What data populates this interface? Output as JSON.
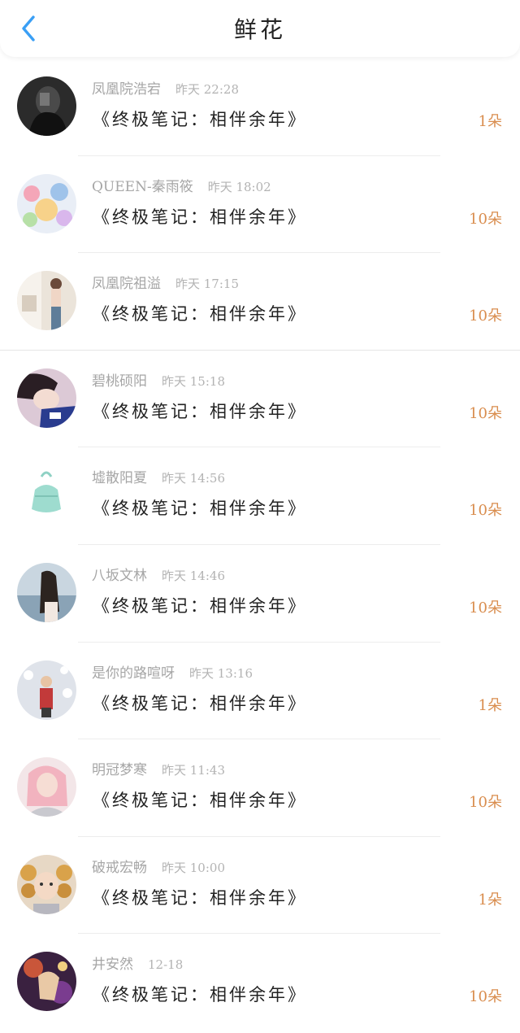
{
  "header": {
    "title": "鲜花",
    "back_icon": "chevron-left-icon",
    "accent_color": "#3a9ff5"
  },
  "colors": {
    "count": "#d98d4e",
    "meta": "#a6a6a6"
  },
  "rows": [
    {
      "name": "凤凰院浩宕",
      "time": "昨天 22:28",
      "book": "《终极笔记：相伴余年》",
      "count": "1朵",
      "avatar": "dark-portrait"
    },
    {
      "name": "QUEEN-秦雨筱",
      "time": "昨天 18:02",
      "book": "《终极笔记：相伴余年》",
      "count": "10朵",
      "avatar": "cartoon-art"
    },
    {
      "name": "凤凰院祖溢",
      "time": "昨天 17:15",
      "book": "《终极笔记：相伴余年》",
      "count": "10朵",
      "avatar": "room-photo"
    },
    {
      "name": "碧桃硕阳",
      "time": "昨天 15:18",
      "book": "《终极笔记：相伴余年》",
      "count": "10朵",
      "avatar": "person-photo"
    },
    {
      "name": "墟散阳夏",
      "time": "昨天 14:56",
      "book": "《终极笔记：相伴余年》",
      "count": "10朵",
      "avatar": "green-bag"
    },
    {
      "name": "八坂文林",
      "time": "昨天 14:46",
      "book": "《终极笔记：相伴余年》",
      "count": "10朵",
      "avatar": "sea-portrait"
    },
    {
      "name": "是你的路喧呀",
      "time": "昨天 13:16",
      "book": "《终极笔记：相伴余年》",
      "count": "1朵",
      "avatar": "snow-figure"
    },
    {
      "name": "明冠梦寒",
      "time": "昨天 11:43",
      "book": "《终极笔记：相伴余年》",
      "count": "10朵",
      "avatar": "pink-hair"
    },
    {
      "name": "破戒宏畅",
      "time": "昨天 10:00",
      "book": "《终极笔记：相伴余年》",
      "count": "1朵",
      "avatar": "curly-child"
    },
    {
      "name": "井安然",
      "time": "12-18",
      "book": "《终极笔记：相伴余年》",
      "count": "10朵",
      "avatar": "anime-art"
    }
  ]
}
